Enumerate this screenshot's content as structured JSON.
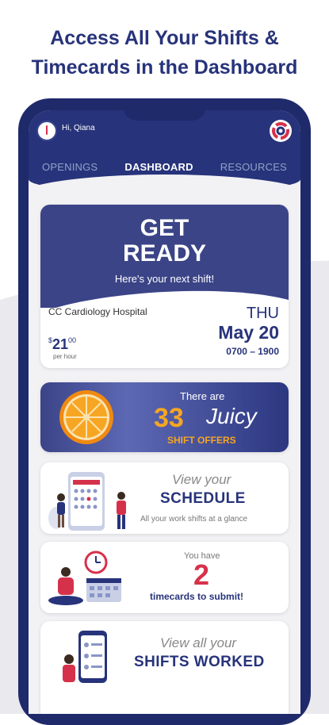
{
  "headline": {
    "line1": "Access All Your Shifts &",
    "line2": "Timecards in the Dashboard"
  },
  "app": {
    "greeting": "Hi, Qiana",
    "tabs": [
      {
        "label": "OPENINGS",
        "active": false
      },
      {
        "label": "DASHBOARD",
        "active": true
      },
      {
        "label": "RESOURCES",
        "active": false
      }
    ]
  },
  "next_shift": {
    "title_line1": "GET",
    "title_line2": "READY",
    "subtitle": "Here's your next shift!",
    "hospital": "CC Cardiology Hospital",
    "pay_dollar_sign": "$",
    "pay_amount": "21",
    "pay_cents": "00",
    "pay_unit": "per hour",
    "day": "THU",
    "date": "May 20",
    "hours": "0700 – 1900"
  },
  "offers": {
    "intro": "There are",
    "count": "33",
    "word": "Juicy",
    "label": "SHIFT OFFERS"
  },
  "schedule": {
    "lead": "View your",
    "title": "SCHEDULE",
    "note": "All your work shifts at a glance"
  },
  "timecards": {
    "lead": "You have",
    "count": "2",
    "note": "timecards to submit!"
  },
  "worked": {
    "lead": "View all your",
    "title": "SHIFTS WORKED"
  },
  "colors": {
    "navy": "#27337a",
    "accent_orange": "#f5a623",
    "brand_red": "#d6314b"
  }
}
